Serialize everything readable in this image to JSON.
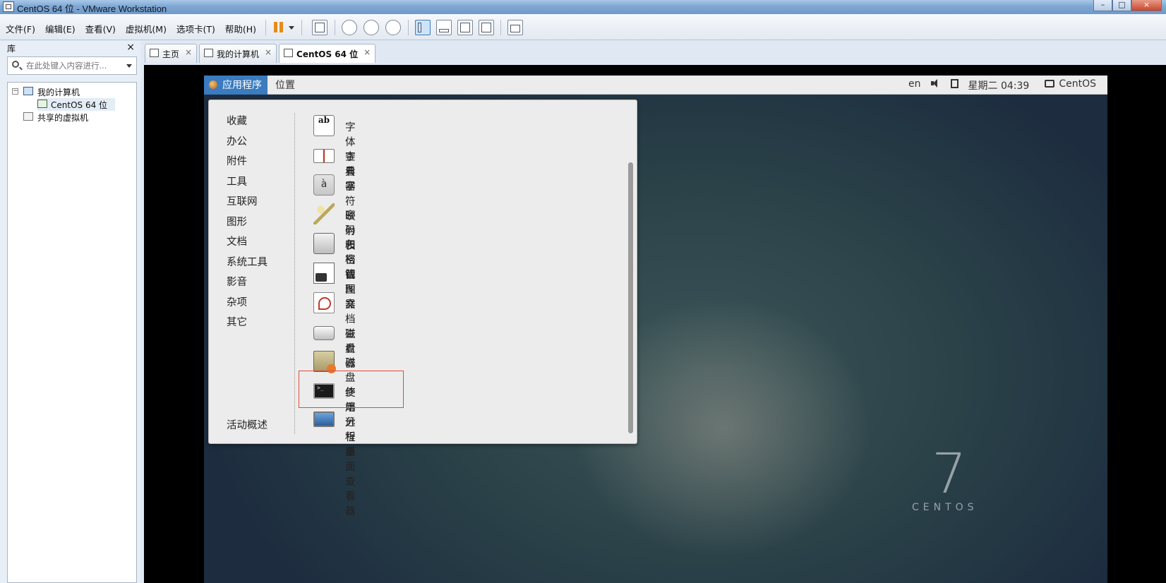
{
  "window": {
    "title": "CentOS 64 位 - VMware Workstation"
  },
  "menubar": [
    "文件(F)",
    "编辑(E)",
    "查看(V)",
    "虚拟机(M)",
    "选项卡(T)",
    "帮助(H)"
  ],
  "library": {
    "title": "库",
    "close": "×",
    "search_placeholder": "在此处键入内容进行...",
    "tree": {
      "my_computer": "我的计算机",
      "vm": "CentOS 64 位",
      "shared": "共享的虚拟机",
      "expand_mark": "−"
    }
  },
  "tabs": [
    {
      "label": "主页"
    },
    {
      "label": "我的计算机"
    },
    {
      "label": "CentOS 64 位"
    }
  ],
  "tab_close": "×",
  "gnome": {
    "apps_label": "应用程序",
    "places_label": "位置",
    "lang": "en",
    "clock": "星期二 04:39",
    "user": "CentOS"
  },
  "categories": [
    "收藏",
    "办公",
    "附件",
    "工具",
    "互联网",
    "图形",
    "文档",
    "系统工具",
    "影音",
    "杂项",
    "其它"
  ],
  "activities": "活动概述",
  "applications": [
    {
      "label": "字体查看器",
      "icon": "font-viewer-icon"
    },
    {
      "label": "字典",
      "icon": "dictionary-icon"
    },
    {
      "label": "字符映射表",
      "icon": "character-map-icon"
    },
    {
      "label": "密码和密钥",
      "icon": "keys-icon"
    },
    {
      "label": "归档管理器",
      "icon": "archive-manager-icon"
    },
    {
      "label": "截图",
      "icon": "screenshot-icon"
    },
    {
      "label": "文档查看器",
      "icon": "document-viewer-icon"
    },
    {
      "label": "磁盘",
      "icon": "disks-icon"
    },
    {
      "label": "磁盘使用分析器",
      "icon": "disk-usage-icon"
    },
    {
      "label": "终端",
      "icon": "terminal-icon"
    },
    {
      "label": "远程桌面查看器",
      "icon": "remote-desktop-icon"
    }
  ],
  "icon_text": {
    "font": "ab",
    "char": "à"
  },
  "wallpaper": {
    "number": "7",
    "word": "CENTOS"
  },
  "colors": {
    "apps_button": "#3b7bbf",
    "highlight_box": "#e14b3c",
    "topbar": "#ececec"
  }
}
